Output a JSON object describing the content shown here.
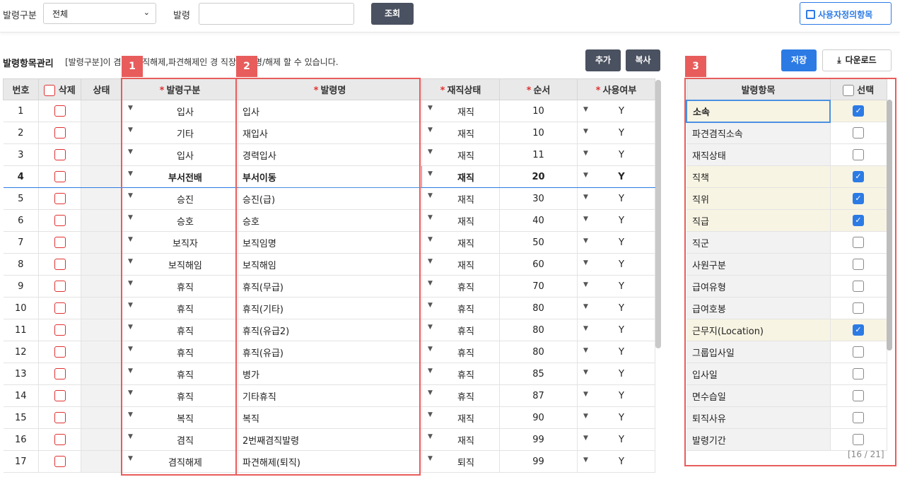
{
  "filter": {
    "type_label": "발령구분",
    "type_value": "전체",
    "order_label": "발령",
    "search_label": "조회",
    "custom_items_label": "사용자정의항목"
  },
  "section": {
    "title": "발령항목관리",
    "description": "[발령구분]이 겸 건,겸직해제,파견해제인 경 직장을 임명/해제 할 수 있습니다.",
    "add_label": "추가",
    "copy_label": "복사",
    "save_label": "저장",
    "download_label": "다운로드"
  },
  "badges": [
    "1",
    "2",
    "3"
  ],
  "main_grid": {
    "headers": {
      "no": "번호",
      "delete": "삭제",
      "status": "상태",
      "type": "발령구분",
      "name": "발령명",
      "work_state": "재직상태",
      "order": "순서",
      "use": "사용여부"
    },
    "rows": [
      {
        "no": "1",
        "type": "입사",
        "name": "입사",
        "state": "재직",
        "order": "10",
        "use": "Y"
      },
      {
        "no": "2",
        "type": "기타",
        "name": "재입사",
        "state": "재직",
        "order": "10",
        "use": "Y"
      },
      {
        "no": "3",
        "type": "입사",
        "name": "경력입사",
        "state": "재직",
        "order": "11",
        "use": "Y"
      },
      {
        "no": "4",
        "type": "부서전배",
        "name": "부서이동",
        "state": "재직",
        "order": "20",
        "use": "Y"
      },
      {
        "no": "5",
        "type": "승진",
        "name": "승진(급)",
        "state": "재직",
        "order": "30",
        "use": "Y"
      },
      {
        "no": "6",
        "type": "승호",
        "name": "승호",
        "state": "재직",
        "order": "40",
        "use": "Y"
      },
      {
        "no": "7",
        "type": "보직자",
        "name": "보직임명",
        "state": "재직",
        "order": "50",
        "use": "Y"
      },
      {
        "no": "8",
        "type": "보직해임",
        "name": "보직해임",
        "state": "재직",
        "order": "60",
        "use": "Y"
      },
      {
        "no": "9",
        "type": "휴직",
        "name": "휴직(무급)",
        "state": "휴직",
        "order": "70",
        "use": "Y"
      },
      {
        "no": "10",
        "type": "휴직",
        "name": "휴직(기타)",
        "state": "휴직",
        "order": "80",
        "use": "Y"
      },
      {
        "no": "11",
        "type": "휴직",
        "name": "휴직(유급2)",
        "state": "휴직",
        "order": "80",
        "use": "Y"
      },
      {
        "no": "12",
        "type": "휴직",
        "name": "휴직(유급)",
        "state": "휴직",
        "order": "80",
        "use": "Y"
      },
      {
        "no": "13",
        "type": "휴직",
        "name": "병가",
        "state": "휴직",
        "order": "85",
        "use": "Y"
      },
      {
        "no": "14",
        "type": "휴직",
        "name": "기타휴직",
        "state": "휴직",
        "order": "87",
        "use": "Y"
      },
      {
        "no": "15",
        "type": "복직",
        "name": "복직",
        "state": "재직",
        "order": "90",
        "use": "Y"
      },
      {
        "no": "16",
        "type": "겸직",
        "name": "2번째겸직발령",
        "state": "재직",
        "order": "99",
        "use": "Y"
      },
      {
        "no": "17",
        "type": "겸직해제",
        "name": "파견해제(퇴직)",
        "state": "퇴직",
        "order": "99",
        "use": "Y"
      }
    ]
  },
  "side_grid": {
    "headers": {
      "item": "발령항목",
      "select": "선택"
    },
    "rows": [
      {
        "label": "소속",
        "checked": true
      },
      {
        "label": "파견겸직소속",
        "checked": false
      },
      {
        "label": "재직상태",
        "checked": false
      },
      {
        "label": "직책",
        "checked": true
      },
      {
        "label": "직위",
        "checked": true
      },
      {
        "label": "직급",
        "checked": true
      },
      {
        "label": "직군",
        "checked": false
      },
      {
        "label": "사원구분",
        "checked": false
      },
      {
        "label": "급여유형",
        "checked": false
      },
      {
        "label": "급여호봉",
        "checked": false
      },
      {
        "label": "근무지(Location)",
        "checked": true
      },
      {
        "label": "그룹입사일",
        "checked": false
      },
      {
        "label": "입사일",
        "checked": false
      },
      {
        "label": "면수습일",
        "checked": false
      },
      {
        "label": "퇴직사유",
        "checked": false
      },
      {
        "label": "발령기간",
        "checked": false
      }
    ],
    "pager": "[16 / 21]"
  },
  "colors": {
    "accent": "#2c7be5",
    "dark_button": "#4a5160",
    "highlight": "#e85c5c",
    "checked_row": "#f8f4e3"
  }
}
